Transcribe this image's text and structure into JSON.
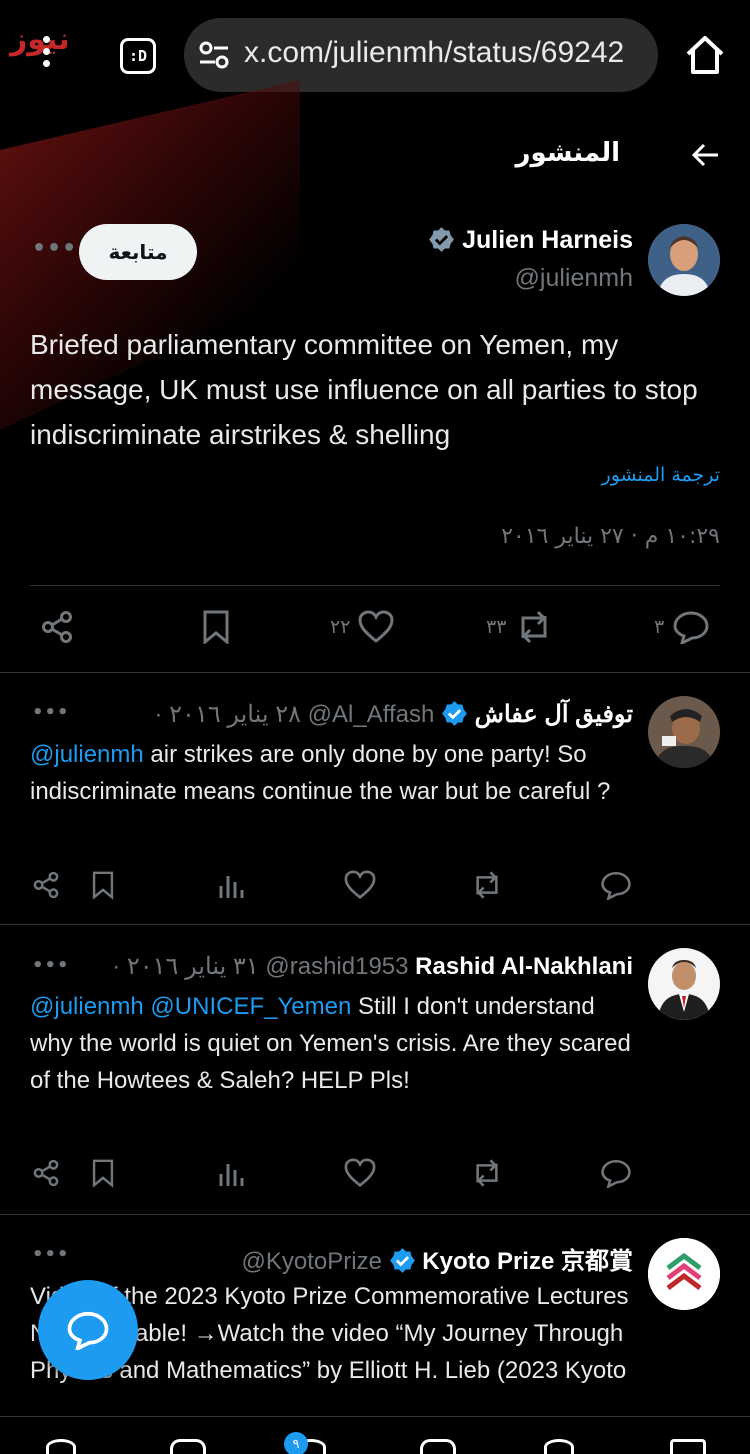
{
  "browser": {
    "brand": "نيوز",
    "tab_label": ":D",
    "url": "x.com/julienmh/status/69242"
  },
  "header": {
    "title": "المنشور"
  },
  "post": {
    "author_name": "Julien Harneis",
    "author_handle": "@julienmh",
    "follow_label": "متابعة",
    "text": "Briefed parliamentary committee on Yemen, my message, UK must use influence on all parties to stop indiscriminate airstrikes & shelling",
    "translate_label": "ترجمة المنشور",
    "timestamp": "١٠:٢٩ م · ٢٧ يناير ٢٠١٦",
    "counts": {
      "replies": "٣",
      "reposts": "٣٣",
      "likes": "٢٢"
    }
  },
  "replies": [
    {
      "name": "توفيق آل عفاش",
      "handle": "@Al_Affash",
      "date": "· ٢٨ يناير ٢٠١٦",
      "mentions": "@julienmh",
      "text": " air strikes are only done by one party! So indiscriminate means continue the war but be careful ?"
    },
    {
      "name": "Rashid Al-Nakhlani",
      "handle": "@rashid1953",
      "date": "· ٣١ يناير ٢٠١٦",
      "mentions": "@julienmh @UNICEF_Yemen",
      "text": " Still I don't understand why the world is quiet on Yemen's crisis. Are they scared of the Howtees & Saleh? HELP Pls!"
    },
    {
      "name": "Kyoto Prize 京都賞",
      "handle": "@KyotoPrize",
      "date": "",
      "mentions": "",
      "text": "Video of the 2023 Kyoto Prize Commemorative Lectures Now Available! →Watch the video “My Journey Through Physics and Mathematics” by Elliott H. Lieb (2023 Kyoto"
    }
  ],
  "nav": {
    "badge": "٩"
  },
  "colors": {
    "accent": "#1d9bf0",
    "background": "#000000",
    "muted": "#71767b"
  }
}
